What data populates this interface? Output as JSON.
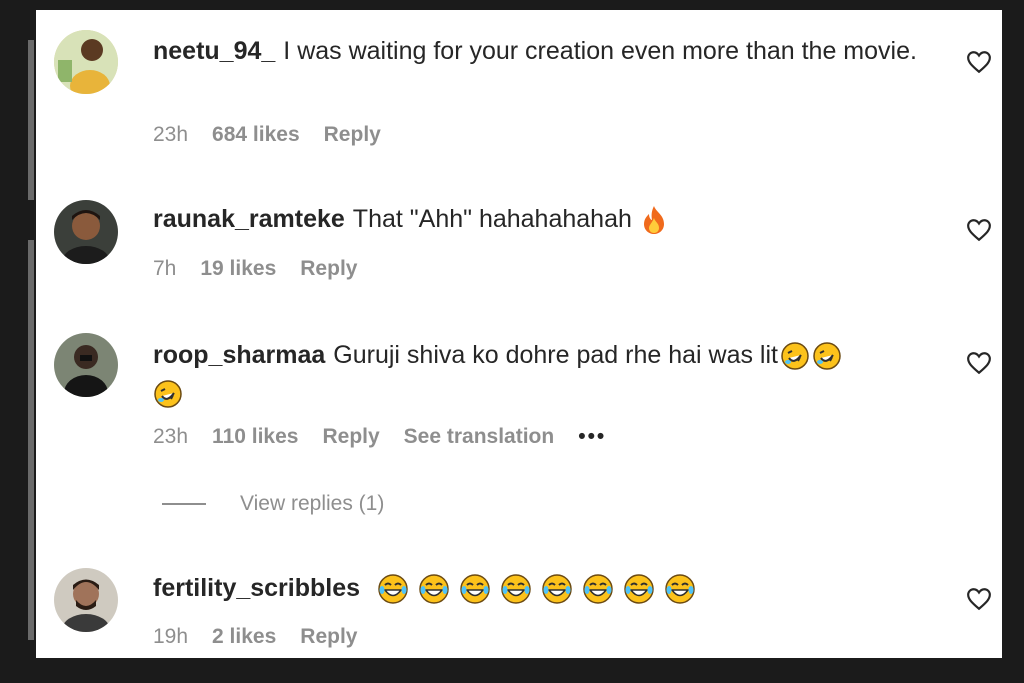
{
  "comments": [
    {
      "username": "neetu_94_",
      "text": "I was waiting for your creation even more than the movie.",
      "time": "23h",
      "likes": "684 likes",
      "reply": "Reply"
    },
    {
      "username": "raunak_ramteke",
      "text": "That \"Ahh\" hahahahahah",
      "time": "7h",
      "likes": "19 likes",
      "reply": "Reply"
    },
    {
      "username": "roop_sharmaa",
      "text": "Guruji shiva ko dohre pad rhe hai was lit",
      "time": "23h",
      "likes": "110 likes",
      "reply": "Reply",
      "translate": "See translation",
      "more": "•••"
    },
    {
      "username": "fertility_scribbles",
      "text": "",
      "time": "19h",
      "likes": "2 likes",
      "reply": "Reply"
    }
  ],
  "view_replies": "View replies (1)",
  "colors": {
    "text": "#262626",
    "secondary": "#8e8e8e",
    "background": "#ffffff",
    "frame": "#1b1b1b"
  },
  "icons": {
    "like": "heart-icon",
    "fire": "fire-emoji",
    "rofl": "rofl-emoji",
    "joy": "joy-emoji"
  }
}
